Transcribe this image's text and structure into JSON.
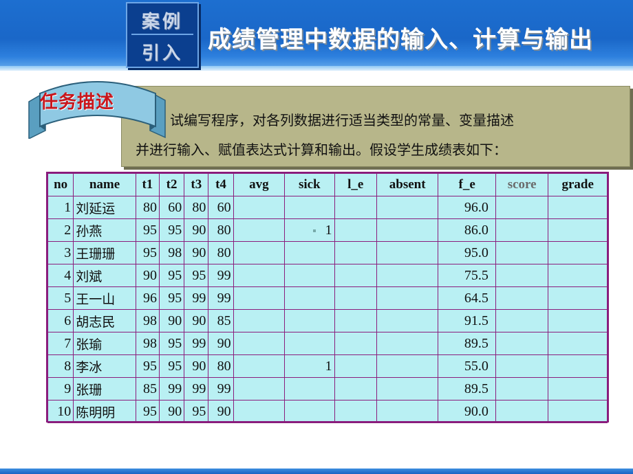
{
  "header": {
    "badge_line1": "案例",
    "badge_line2": "引入",
    "title": "成绩管理中数据的输入、计算与输出"
  },
  "task": {
    "ribbon_label": "任务描述",
    "line1": "试编写程序，对各列数据进行适当类型的常量、变量描述",
    "line2": "并进行输入、赋值表达式计算和输出。假设学生成绩表如下："
  },
  "table": {
    "headers": [
      "no",
      "name",
      "t1",
      "t2",
      "t3",
      "t4",
      "avg",
      "sick",
      "l_e",
      "absent",
      "f_e",
      "score",
      "grade"
    ],
    "rows": [
      {
        "no": "1",
        "name": "刘延运",
        "t1": "80",
        "t2": "60",
        "t3": "80",
        "t4": "60",
        "avg": "",
        "sick": "",
        "l_e": "",
        "absent": "",
        "f_e": "96.0",
        "score": "",
        "grade": ""
      },
      {
        "no": "2",
        "name": "孙燕",
        "t1": "95",
        "t2": "95",
        "t3": "90",
        "t4": "80",
        "avg": "",
        "sick": "1",
        "l_e": "",
        "absent": "",
        "f_e": "86.0",
        "score": "",
        "grade": ""
      },
      {
        "no": "3",
        "name": "王珊珊",
        "t1": "95",
        "t2": "98",
        "t3": "90",
        "t4": "80",
        "avg": "",
        "sick": "",
        "l_e": "",
        "absent": "",
        "f_e": "95.0",
        "score": "",
        "grade": ""
      },
      {
        "no": "4",
        "name": "刘斌",
        "t1": "90",
        "t2": "95",
        "t3": "95",
        "t4": "99",
        "avg": "",
        "sick": "",
        "l_e": "",
        "absent": "",
        "f_e": "75.5",
        "score": "",
        "grade": ""
      },
      {
        "no": "5",
        "name": "王一山",
        "t1": "96",
        "t2": "95",
        "t3": "99",
        "t4": "99",
        "avg": "",
        "sick": "",
        "l_e": "",
        "absent": "",
        "f_e": "64.5",
        "score": "",
        "grade": ""
      },
      {
        "no": "6",
        "name": "胡志民",
        "t1": "98",
        "t2": "90",
        "t3": "90",
        "t4": "85",
        "avg": "",
        "sick": "",
        "l_e": "",
        "absent": "",
        "f_e": "91.5",
        "score": "",
        "grade": ""
      },
      {
        "no": "7",
        "name": "张瑜",
        "t1": "98",
        "t2": "95",
        "t3": "99",
        "t4": "90",
        "avg": "",
        "sick": "",
        "l_e": "",
        "absent": "",
        "f_e": "89.5",
        "score": "",
        "grade": ""
      },
      {
        "no": "8",
        "name": "李冰",
        "t1": "95",
        "t2": "95",
        "t3": "90",
        "t4": "80",
        "avg": "",
        "sick": "1",
        "l_e": "",
        "absent": "",
        "f_e": "55.0",
        "score": "",
        "grade": ""
      },
      {
        "no": "9",
        "name": "张珊",
        "t1": "85",
        "t2": "99",
        "t3": "99",
        "t4": "99",
        "avg": "",
        "sick": "",
        "l_e": "",
        "absent": "",
        "f_e": "89.5",
        "score": "",
        "grade": ""
      },
      {
        "no": "10",
        "name": "陈明明",
        "t1": "95",
        "t2": "90",
        "t3": "95",
        "t4": "90",
        "avg": "",
        "sick": "",
        "l_e": "",
        "absent": "",
        "f_e": "90.0",
        "score": "",
        "grade": ""
      }
    ]
  },
  "colors": {
    "banner": "#1a67c8",
    "table_bg": "#b9f0f3",
    "table_border": "#8a1c7c",
    "desc_bg": "#b7b68a",
    "ribbon": "#8fc9e3",
    "ribbon_text": "#c8161c"
  }
}
